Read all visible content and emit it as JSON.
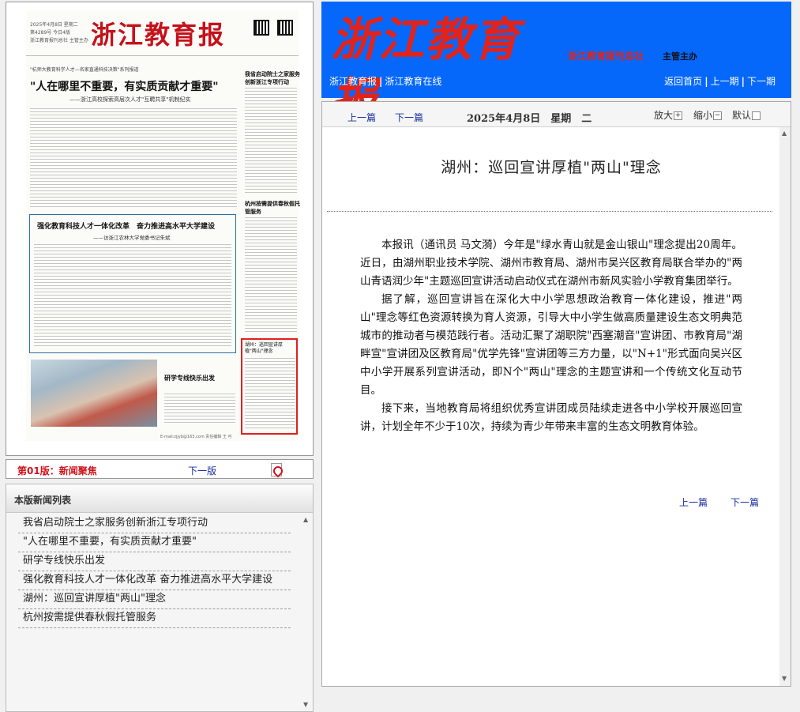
{
  "newspaper_thumb": {
    "masthead_logo": "浙江教育报",
    "masthead_meta": [
      "2025年4月8日 星期二",
      "第4289号 今日4版",
      "浙江教育报刊总社 主管主办"
    ],
    "kicker": "\"杭师大教育科学人才—名家直通科技决策\"系列报道",
    "headline": "\"人在哪里不重要，有实质贡献才重要\"",
    "subhead": "——浙江高校探索高层次人才\"互聘共享\"机制纪实",
    "side_story": "我省启动院士之家服务创新浙江专项行动",
    "side_story2": "杭州按需提供春秋假托管服务",
    "box_title": "强化教育科技人才一体化改革　奋力推进高水平大学建设",
    "box_sub": "——访浙江农林大学党委书记朱斌",
    "photo_title": "研学专线快乐出发",
    "red_box_title": "湖州：巡回宣讲厚植\"两山\"理念",
    "footer": "E-mail:zjjyb@163.com 责任编辑 王 可"
  },
  "page_bar": {
    "page_name": "第01版：新闻聚焦",
    "next_page": "下一版",
    "pdf_icon": "pdf-icon"
  },
  "news_list": {
    "title": "本版新闻列表",
    "items": [
      "我省启动院士之家服务创新浙江专项行动",
      "\"人在哪里不重要，有实质贡献才重要\"",
      "研学专线快乐出发",
      "强化教育科技人才一体化改革 奋力推进高水平大学建设",
      "湖州：巡回宣讲厚植\"两山\"理念",
      "杭州按需提供春秋假托管服务"
    ]
  },
  "banner": {
    "logo": "浙江教育报",
    "org": "浙江教育报刊总社",
    "org_role": "主管主办",
    "links_left": [
      "浙江教育报",
      "浙江教育在线"
    ],
    "links_right": [
      "返回首页",
      "上一期",
      "下一期"
    ],
    "bg_color": "#0568fb",
    "logo_color": "#e2231a"
  },
  "toolbar": {
    "prev": "上一篇",
    "next": "下一篇",
    "date": "2025年4月8日　星期　二",
    "zoom_in": "放大",
    "zoom_out": "缩小",
    "default": "默认"
  },
  "article": {
    "title": "湖州：巡回宣讲厚植\"两山\"理念",
    "paragraphs": [
      "本报讯（通讯员 马文漪）今年是\"绿水青山就是金山银山\"理念提出20周年。近日，由湖州职业技术学院、湖州市教育局、湖州市吴兴区教育局联合举办的\"两山青语润少年\"主题巡回宣讲活动启动仪式在湖州市新风实验小学教育集团举行。",
      "据了解，巡回宣讲旨在深化大中小学思想政治教育一体化建设，推进\"两山\"理念等红色资源转换为育人资源，引导大中小学生做高质量建设生态文明典范城市的推动者与模范践行者。活动汇聚了湖职院\"西塞潮音\"宣讲团、市教育局\"湖畔宣\"宣讲团及区教育局\"优学先锋\"宣讲团等三方力量，以\"N+1\"形式面向吴兴区中小学开展系列宣讲活动，即N个\"两山\"理念的主题宣讲和一个传统文化互动节目。",
      "接下来，当地教育局将组织优秀宣讲团成员陆续走进各中小学校开展巡回宣讲，计划全年不少于10次，持续为青少年带来丰富的生态文明教育体验。"
    ],
    "bottom_prev": "上一篇",
    "bottom_next": "下一篇"
  }
}
